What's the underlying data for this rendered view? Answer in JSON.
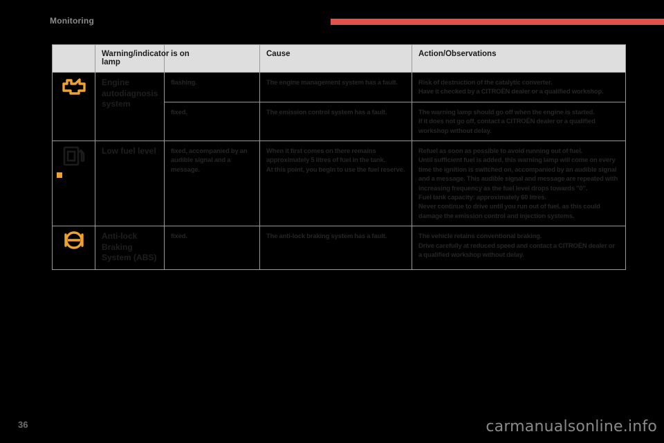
{
  "header": {
    "section_title": "Monitoring",
    "accent_color": "#e3514a"
  },
  "table": {
    "columns": [
      {
        "key": "symbol",
        "label": ""
      },
      {
        "key": "lamp",
        "label": "Warning/indicator lamp"
      },
      {
        "key": "ison",
        "label": "is on"
      },
      {
        "key": "cause",
        "label": "Cause"
      },
      {
        "key": "action",
        "label": "Action/Observations"
      }
    ],
    "rows": [
      {
        "icon": "engine-check-icon",
        "icon_color": "#efa22c",
        "name": "Engine autodiagnosis system",
        "states": [
          {
            "is_on": "flashing.",
            "cause": "The engine management system has a fault.",
            "action": "Risk of destruction of the catalytic converter.\nHave it checked by a CITROËN dealer or a qualified workshop."
          },
          {
            "is_on": "fixed.",
            "cause": "The emission control system has a fault.",
            "action": "The warning lamp should go off when the engine is started.\nIf it does not go off, contact a CITROËN dealer or a qualified workshop without delay."
          }
        ]
      },
      {
        "icon": "fuel-pump-icon",
        "icon_color": "#efa22c",
        "name": "Low fuel level",
        "states": [
          {
            "is_on": "fixed, accompanied by an audible signal and a message.",
            "cause": "When it first comes on there remains approximately 5 litres of fuel in the tank.\nAt this point, you begin to use the fuel reserve.",
            "action": "Refuel as soon as possible to avoid running out of fuel.\nUntil sufficient fuel is added, this warning lamp will come on every time the ignition is switched on, accompanied by an audible signal and a message. This audible signal and message are repeated with increasing frequency as the fuel level drops towards \"0\".\nFuel tank capacity: approximately 60 litres.\nNever continue to drive until you run out of fuel, as this could damage the emission control and injection systems."
          }
        ]
      },
      {
        "icon": "abs-icon",
        "icon_color": "#efa22c",
        "name": "Anti-lock Braking System (ABS)",
        "states": [
          {
            "is_on": "fixed.",
            "cause": "The anti-lock braking system has a fault.",
            "action": "The vehicle retains conventional braking.\nDrive carefully at reduced speed and contact a CITROËN dealer or a qualified workshop without delay."
          }
        ]
      }
    ]
  },
  "footer": {
    "page_number": "36",
    "watermark": "carmanualsonline.info"
  }
}
